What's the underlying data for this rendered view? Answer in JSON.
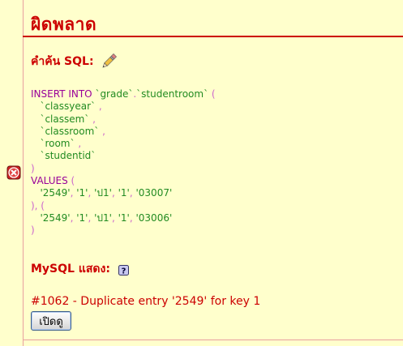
{
  "title": "ผิดพลาด",
  "sql_heading": "คำค้น SQL:",
  "sql_lines": [
    [
      {
        "t": "INSERT INTO ",
        "c": "kw"
      },
      {
        "t": "`grade`",
        "c": "id"
      },
      {
        "t": ".",
        "c": "punc"
      },
      {
        "t": "`studentroom`",
        "c": "id"
      },
      {
        "t": " (",
        "c": "punc"
      }
    ],
    [
      {
        "t": "   `classyear`",
        "c": "id"
      },
      {
        "t": " ,",
        "c": "punc"
      }
    ],
    [
      {
        "t": "   `classem`",
        "c": "id"
      },
      {
        "t": " ,",
        "c": "punc"
      }
    ],
    [
      {
        "t": "   `classroom`",
        "c": "id"
      },
      {
        "t": " ,",
        "c": "punc"
      }
    ],
    [
      {
        "t": "   `room`",
        "c": "id"
      },
      {
        "t": " ,",
        "c": "punc"
      }
    ],
    [
      {
        "t": "   `studentid`",
        "c": "id"
      }
    ],
    [
      {
        "t": ")",
        "c": "punc"
      }
    ],
    [
      {
        "t": "VALUES ",
        "c": "kw"
      },
      {
        "t": "(",
        "c": "punc"
      }
    ],
    [
      {
        "t": "   '2549'",
        "c": "str"
      },
      {
        "t": ", ",
        "c": "punc"
      },
      {
        "t": "'1'",
        "c": "str"
      },
      {
        "t": ", ",
        "c": "punc"
      },
      {
        "t": "'ป1'",
        "c": "str"
      },
      {
        "t": ", ",
        "c": "punc"
      },
      {
        "t": "'1'",
        "c": "str"
      },
      {
        "t": ", ",
        "c": "punc"
      },
      {
        "t": "'03007'",
        "c": "str"
      }
    ],
    [
      {
        "t": "), (",
        "c": "punc"
      }
    ],
    [
      {
        "t": "   '2549'",
        "c": "str"
      },
      {
        "t": ", ",
        "c": "punc"
      },
      {
        "t": "'1'",
        "c": "str"
      },
      {
        "t": ", ",
        "c": "punc"
      },
      {
        "t": "'ป1'",
        "c": "str"
      },
      {
        "t": ", ",
        "c": "punc"
      },
      {
        "t": "'1'",
        "c": "str"
      },
      {
        "t": ", ",
        "c": "punc"
      },
      {
        "t": "'03006'",
        "c": "str"
      }
    ],
    [
      {
        "t": ")",
        "c": "punc"
      }
    ]
  ],
  "mysql_heading": "MySQL แสดง:",
  "error_message": "#1062 - Duplicate entry '2549' for key 1",
  "open_button_label": "เปิดดู",
  "icons": {
    "edit": "pencil-icon",
    "error": "error-icon",
    "help": "help-icon"
  },
  "colors": {
    "background": "#ffffcc",
    "heading": "#cc0000",
    "keyword": "#990099",
    "identifier": "#228b22",
    "punctuation": "#cc66cc"
  }
}
